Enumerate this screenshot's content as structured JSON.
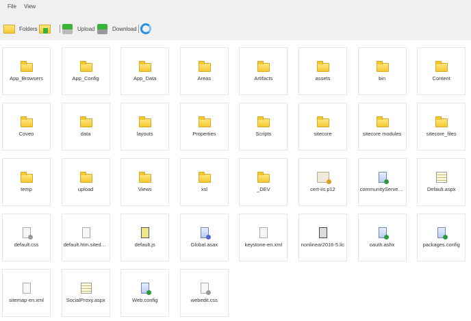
{
  "menu": {
    "file": "File",
    "view": "View"
  },
  "toolbar": {
    "folders": "Folders",
    "upload": "Upload",
    "download": "Download",
    "icons": [
      "folders-icon",
      "new-folder-icon",
      "upload-icon",
      "download-icon",
      "refresh-icon"
    ]
  },
  "items": [
    {
      "name": "App_Browsers",
      "type": "folder"
    },
    {
      "name": "App_Config",
      "type": "folder"
    },
    {
      "name": "App_Data",
      "type": "folder"
    },
    {
      "name": "Areas",
      "type": "folder"
    },
    {
      "name": "Artifacts",
      "type": "folder"
    },
    {
      "name": "assets",
      "type": "folder"
    },
    {
      "name": "bin",
      "type": "folder"
    },
    {
      "name": "Content",
      "type": "folder"
    },
    {
      "name": "Coveo",
      "type": "folder"
    },
    {
      "name": "data",
      "type": "folder"
    },
    {
      "name": "layouts",
      "type": "folder"
    },
    {
      "name": "Properties",
      "type": "folder"
    },
    {
      "name": "Scripts",
      "type": "folder"
    },
    {
      "name": "sitecore",
      "type": "folder"
    },
    {
      "name": "sitecore modules",
      "type": "folder"
    },
    {
      "name": "sitecore_files",
      "type": "folder"
    },
    {
      "name": "temp",
      "type": "folder"
    },
    {
      "name": "upload",
      "type": "folder"
    },
    {
      "name": "Views",
      "type": "folder"
    },
    {
      "name": "xsl",
      "type": "folder"
    },
    {
      "name": "_DEV",
      "type": "folder"
    },
    {
      "name": "cert-iis.p12",
      "type": "certificate"
    },
    {
      "name": "communityServer_...",
      "type": "web-service"
    },
    {
      "name": "Default.aspx",
      "type": "aspx"
    },
    {
      "name": "default.css",
      "type": "css"
    },
    {
      "name": "default.htm.sitedown",
      "type": "blank"
    },
    {
      "name": "default.js",
      "type": "script"
    },
    {
      "name": "Global.asax",
      "type": "asax"
    },
    {
      "name": "keystone-en.xml",
      "type": "blank"
    },
    {
      "name": "nonlinear2016-5.lic",
      "type": "text"
    },
    {
      "name": "oauth.ashx",
      "type": "ashx"
    },
    {
      "name": "packages.config",
      "type": "config"
    },
    {
      "name": "sitemap-en.xml",
      "type": "blank"
    },
    {
      "name": "SocialProxy.aspx",
      "type": "aspx"
    },
    {
      "name": "Web.config",
      "type": "config"
    },
    {
      "name": "webedit.css",
      "type": "css"
    }
  ]
}
